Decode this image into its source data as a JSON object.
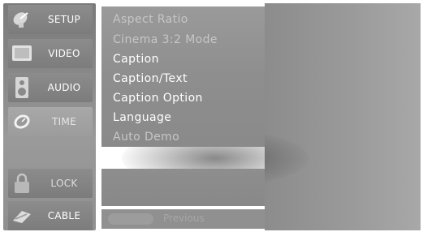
{
  "sidebar": {
    "items": [
      {
        "key": "setup",
        "label": "SETUP",
        "icon": "satellite-dish-icon"
      },
      {
        "key": "video",
        "label": "VIDEO",
        "icon": "tv-screen-icon"
      },
      {
        "key": "audio",
        "label": "AUDIO",
        "icon": "speaker-icon"
      },
      {
        "key": "time",
        "label": "TIME",
        "icon": "clock-icon"
      },
      {
        "key": "lock",
        "label": "LOCK",
        "icon": "padlock-icon"
      },
      {
        "key": "cable",
        "label": "CABLE",
        "icon": "cable-plug-icon"
      }
    ],
    "active": "time"
  },
  "menu": {
    "items": [
      {
        "label": "Aspect Ratio",
        "style": "faded"
      },
      {
        "label": "Cinema 3:2 Mode",
        "style": "faded"
      },
      {
        "label": "Caption",
        "style": "normal"
      },
      {
        "label": "Caption/Text",
        "style": "normal"
      },
      {
        "label": "Caption Option",
        "style": "normal"
      },
      {
        "label": "Language",
        "style": "normal"
      },
      {
        "label": "Auto Demo",
        "style": "faded"
      }
    ]
  },
  "footer": {
    "previous_label": "Previous"
  }
}
